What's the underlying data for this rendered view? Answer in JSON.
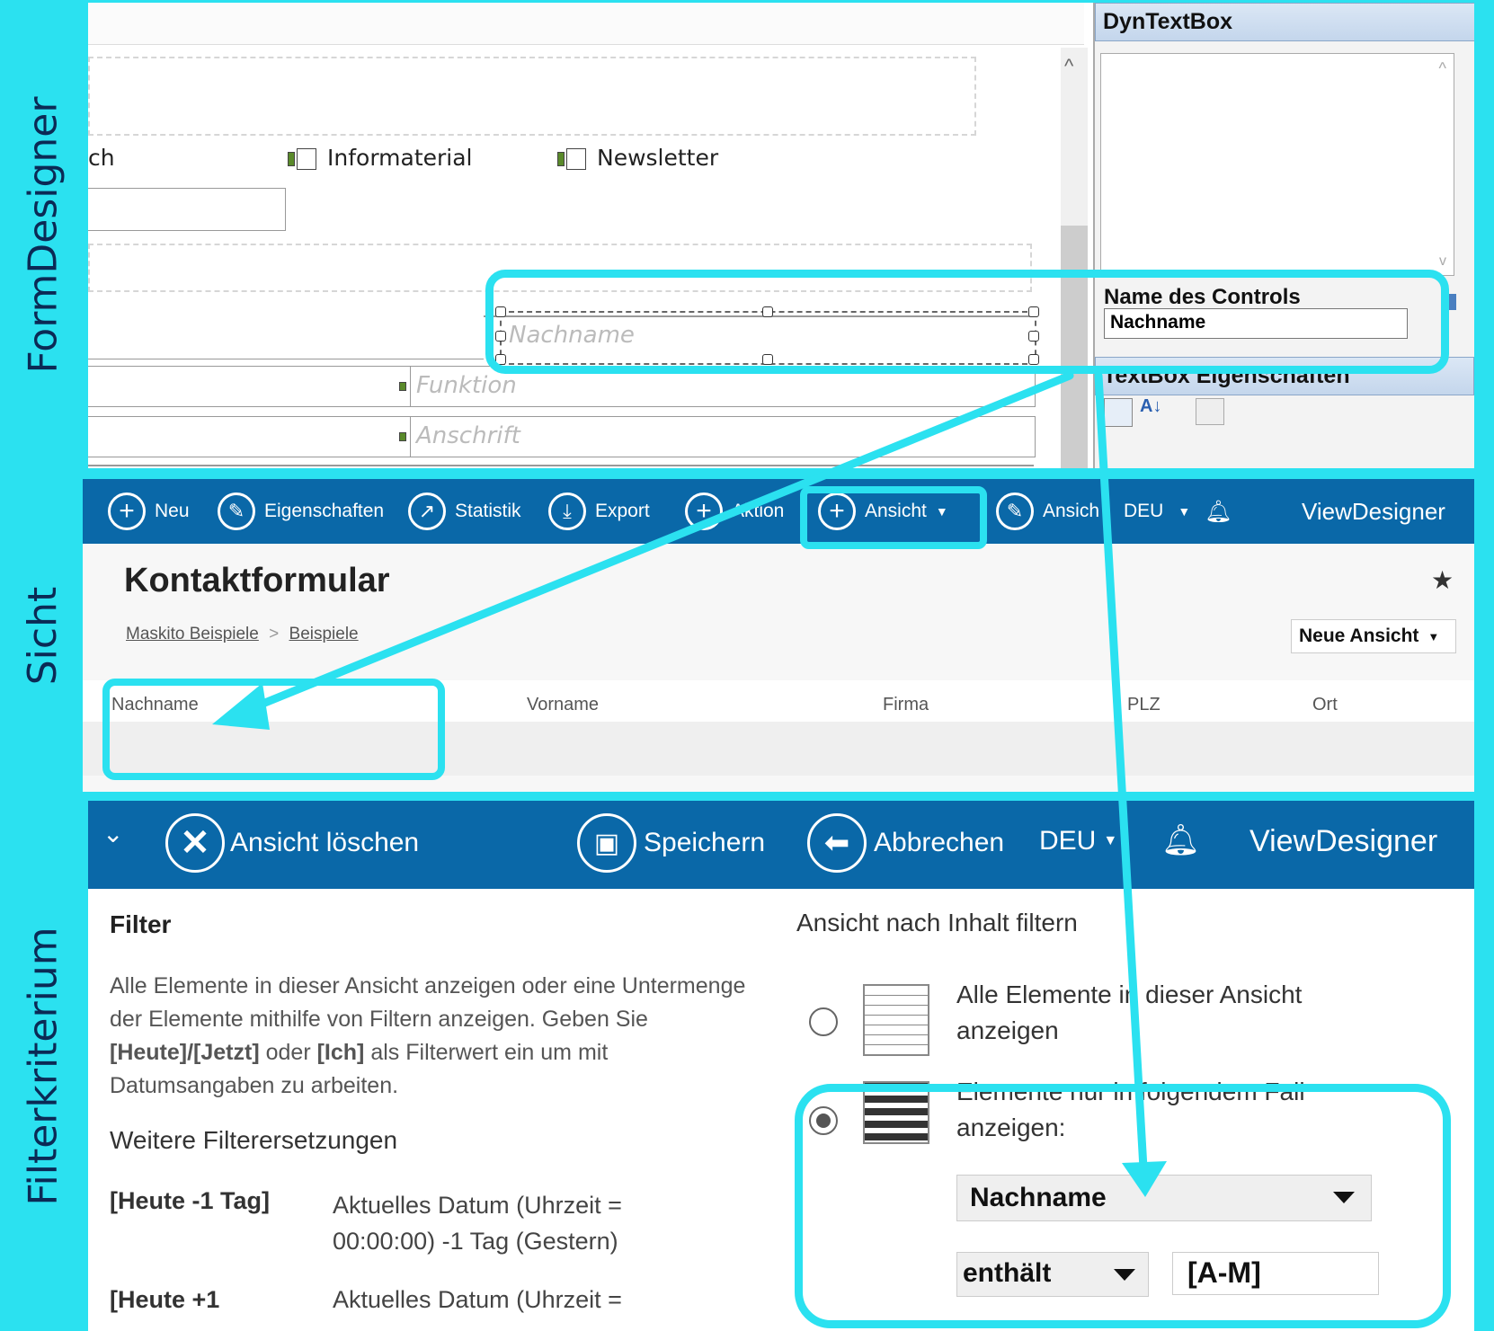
{
  "sections": {
    "formdesigner": "FormDesigner",
    "sicht": "Sicht",
    "filter": "Filterkriterium"
  },
  "formdesigner": {
    "checkbox_partial": "ch",
    "checkbox1": "Informaterial",
    "checkbox2": "Newsletter",
    "placeholder_nachname": "Nachname",
    "placeholder_funktion": "Funktion",
    "placeholder_anschrift": "Anschrift",
    "props": {
      "header": "DynTextBox",
      "control_name_label": "Name des Controls",
      "control_name_value": "Nachname",
      "textbox_props_header": "TextBox Eigenschaften"
    }
  },
  "sicht": {
    "toolbar": [
      {
        "label": "Neu",
        "icon": "plus-circle-icon"
      },
      {
        "label": "Eigenschaften",
        "icon": "pencil-circle-icon"
      },
      {
        "label": "Statistik",
        "icon": "chart-circle-icon"
      },
      {
        "label": "Export",
        "icon": "download-circle-icon"
      },
      {
        "label": "Aktion",
        "icon": "plus-circle-icon"
      },
      {
        "label": "Ansicht",
        "icon": "plus-circle-icon"
      },
      {
        "label": "Ansich",
        "icon": "pencil-circle-icon"
      }
    ],
    "lang": "DEU",
    "app": "ViewDesigner",
    "title": "Kontaktformular",
    "breadcrumb": [
      "Maskito Beispiele",
      "Beispiele"
    ],
    "breadcrumb_sep": ">",
    "view_select": "Neue Ansicht",
    "columns": [
      "Nachname",
      "Vorname",
      "Firma",
      "PLZ",
      "Ort"
    ]
  },
  "filter": {
    "toolbar": {
      "delete": "Ansicht löschen",
      "save": "Speichern",
      "cancel": "Abbrechen",
      "lang": "DEU",
      "app": "ViewDesigner"
    },
    "heading": "Filter",
    "description": "Alle Elemente in dieser Ansicht anzeigen oder eine Untermenge der Elemente mithilfe von Filtern anzeigen. Geben Sie ",
    "desc_heute": "[Heute]/[Jetzt]",
    "desc_oder": " oder ",
    "desc_ich": "[Ich]",
    "desc_end": " als Filterwert ein um mit Datumsangaben zu arbeiten.",
    "weitere": "Weitere Filterersetzungen",
    "rows": [
      {
        "key": "[Heute -1 Tag]",
        "val": "Aktuelles Datum (Uhrzeit = 00:00:00) -1 Tag (Gestern)"
      },
      {
        "key": "[Heute +1",
        "val": "Aktuelles Datum (Uhrzeit ="
      }
    ],
    "right_heading": "Ansicht nach Inhalt filtern",
    "option_all": "Alle Elemente in dieser Ansicht anzeigen",
    "option_filtered": "Elemente nur in folgendem Fall anzeigen:",
    "field": "Nachname",
    "operator": "enthält",
    "value": "[A-M]"
  }
}
